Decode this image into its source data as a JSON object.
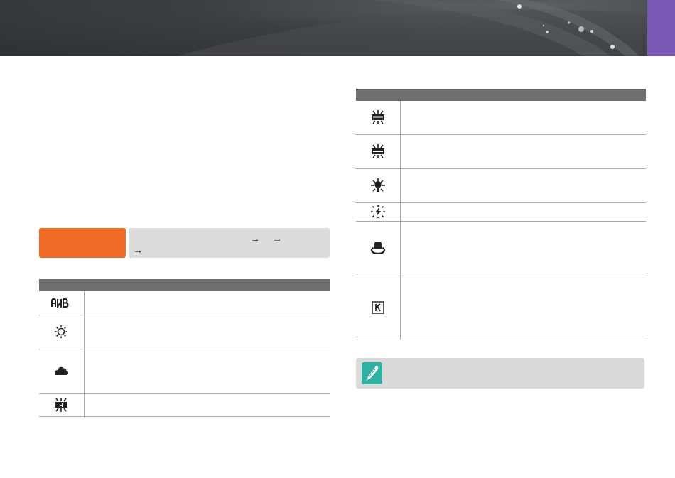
{
  "banner": {
    "accent_color": "#7b57b5",
    "background_color": "#3c3f42"
  },
  "mode_box": {
    "color": "#ef6a25"
  },
  "path": {
    "arrows": [
      "→",
      "→",
      "→"
    ]
  },
  "left_table": {
    "rows": [
      {
        "icon": "awb-icon"
      },
      {
        "icon": "daylight-icon"
      },
      {
        "icon": "cloudy-icon"
      },
      {
        "icon": "fluorescent-h-icon"
      }
    ]
  },
  "right_table": {
    "rows": [
      {
        "icon": "fluorescent-w-icon"
      },
      {
        "icon": "fluorescent-n-icon"
      },
      {
        "icon": "tungsten-icon"
      },
      {
        "icon": "flash-wb-icon"
      },
      {
        "icon": "custom-set-icon"
      },
      {
        "icon": "color-temperature-icon"
      }
    ]
  },
  "note": {
    "icon": "note-pen-icon",
    "color": "#2fb1a3"
  }
}
